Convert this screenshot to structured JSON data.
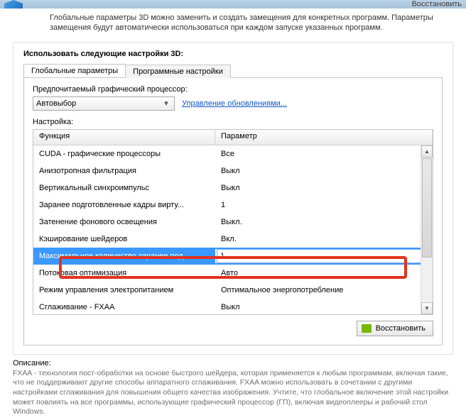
{
  "header": {
    "restore": "Восстановить"
  },
  "intro": "Глобальные параметры 3D можно заменить и создать замещения для конкретных программ. Параметры замещения будут автоматически использоваться при каждом запуске указанных программ.",
  "panel_title": "Использовать следующие настройки 3D:",
  "tabs": {
    "global": "Глобальные параметры",
    "program": "Программные настройки"
  },
  "gp": {
    "label": "Предпочитаемый графический процессор:",
    "value": "Автовыбор",
    "updates": "Управление обновлениями..."
  },
  "settings_label": "Настройка:",
  "columns": {
    "c1": "Функция",
    "c2": "Параметр"
  },
  "rows": [
    {
      "f": "CUDA - графические процессоры",
      "p": "Все"
    },
    {
      "f": "Анизотропная фильтрация",
      "p": "Выкл"
    },
    {
      "f": "Вертикальный синхроимпульс",
      "p": "Выкл"
    },
    {
      "f": "Заранее подготовленные кадры вирту...",
      "p": "1"
    },
    {
      "f": "Затенение фонового освещения",
      "p": "Выкл."
    },
    {
      "f": "Кэширование шейдеров",
      "p": "Вкл."
    },
    {
      "f": "Максимальное количество заранее под...",
      "p": "1"
    },
    {
      "f": "Потоковая оптимизация",
      "p": "Авто"
    },
    {
      "f": "Режим управления электропитанием",
      "p": "Оптимальное энергопотребление"
    },
    {
      "f": "Сглаживание - FXAA",
      "p": "Выкл"
    }
  ],
  "restore_btn": "Восстановить",
  "desc": {
    "title": "Описание:",
    "body": "FXAA - технология пост-обработки на основе быстрого шейдера, которая применяется к любым программам, включая такие, что не поддерживают другие способы аппаратного сглаживания. FXAA можно использовать в сочетании с другими настройками сглаживания для повышения общего качества изображения. Учтите, что глобальное включение этой настройки может повлиять на все программы, использующие графический процессор (ГП), включая видеоплееры и рабочий стол Windows."
  }
}
